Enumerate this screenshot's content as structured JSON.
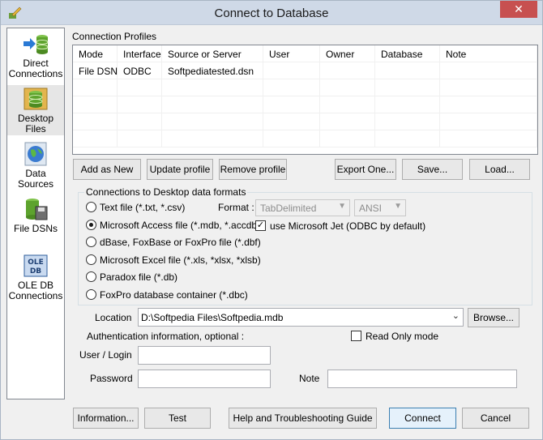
{
  "window": {
    "title": "Connect to Database",
    "close_glyph": "✕"
  },
  "sidebar": {
    "items": [
      {
        "label1": "Direct",
        "label2": "Connections",
        "icon": "database-arrow-icon"
      },
      {
        "label1": "Desktop",
        "label2": "Files",
        "icon": "desktop-files-icon"
      },
      {
        "label1": "Data",
        "label2": "Sources",
        "icon": "globe-icon"
      },
      {
        "label1": "File DSNs",
        "label2": "",
        "icon": "file-dsn-icon"
      },
      {
        "label1": "OLE DB",
        "label2": "Connections",
        "icon": "oledb-icon"
      }
    ]
  },
  "profiles": {
    "group_label": "Connection Profiles",
    "columns": [
      "Mode",
      "Interface",
      "Source or Server",
      "User",
      "Owner",
      "Database",
      "Note"
    ],
    "rows": [
      [
        "File DSN",
        "ODBC",
        "Softpediatested.dsn",
        "",
        "",
        "",
        ""
      ]
    ]
  },
  "profile_buttons": {
    "add": "Add as New",
    "update": "Update profile",
    "remove": "Remove profile",
    "export": "Export One...",
    "save": "Save...",
    "load": "Load..."
  },
  "desktop_formats": {
    "group_label": "Connections to Desktop data formats",
    "format_label": "Format :",
    "format_value": "TabDelimited",
    "charset_value": "ANSI",
    "use_jet_label": "use Microsoft Jet (ODBC by default)",
    "use_jet_checked": true,
    "options": [
      {
        "label": "Text file (*.txt, *.csv)",
        "selected": false
      },
      {
        "label": "Microsoft Access file (*.mdb, *.accdb)",
        "selected": true
      },
      {
        "label": "dBase, FoxBase or FoxPro file (*.dbf)",
        "selected": false
      },
      {
        "label": "Microsoft Excel file (*.xls, *xlsx, *xlsb)",
        "selected": false
      },
      {
        "label": "Paradox file (*.db)",
        "selected": false
      },
      {
        "label": "FoxPro database container (*.dbc)",
        "selected": false
      }
    ]
  },
  "location": {
    "label": "Location",
    "value": "D:\\Softpedia Files\\Softpedia.mdb",
    "browse": "Browse..."
  },
  "auth": {
    "label": "Authentication information, optional :",
    "readonly_label": "Read Only mode",
    "readonly_checked": false,
    "user_label": "User / Login",
    "user_value": "",
    "password_label": "Password",
    "password_value": "",
    "note_label": "Note",
    "note_value": ""
  },
  "footer": {
    "information": "Information...",
    "test": "Test",
    "help": "Help and Troubleshooting Guide",
    "connect": "Connect",
    "cancel": "Cancel"
  }
}
